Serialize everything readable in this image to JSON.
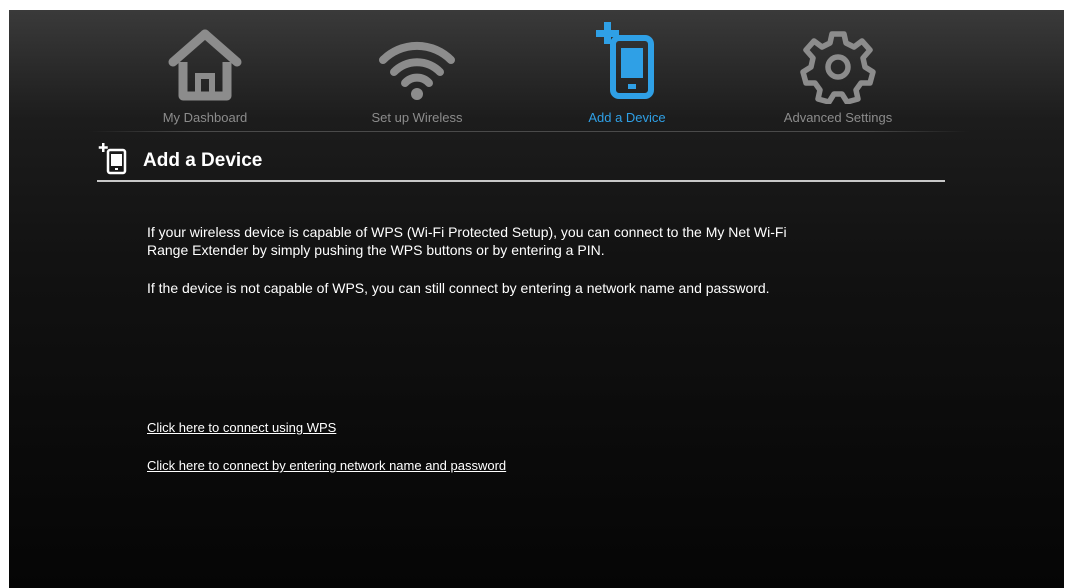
{
  "nav": {
    "items": [
      {
        "label": "My Dashboard",
        "icon": "house-icon",
        "active": false
      },
      {
        "label": "Set up Wireless",
        "icon": "wifi-icon",
        "active": false
      },
      {
        "label": "Add a Device",
        "icon": "add-device-icon",
        "active": true
      },
      {
        "label": "Advanced Settings",
        "icon": "gear-icon",
        "active": false
      }
    ]
  },
  "colors": {
    "accent": "#2fa0e6",
    "inactive_icon": "#8c8c8c",
    "background": "#121212"
  },
  "section": {
    "title": "Add a Device",
    "icon": "add-device-icon"
  },
  "content": {
    "paragraph_1": "If your wireless device is capable of WPS (Wi-Fi Protected Setup), you can connect to the My Net Wi-Fi Range Extender by simply pushing the WPS buttons or by entering a PIN.",
    "paragraph_2": "If the device is not capable of WPS, you can still connect by entering a network name and password."
  },
  "links": {
    "wps": "Click here to connect using WPS",
    "manual": "Click here to connect by entering network name and password"
  }
}
